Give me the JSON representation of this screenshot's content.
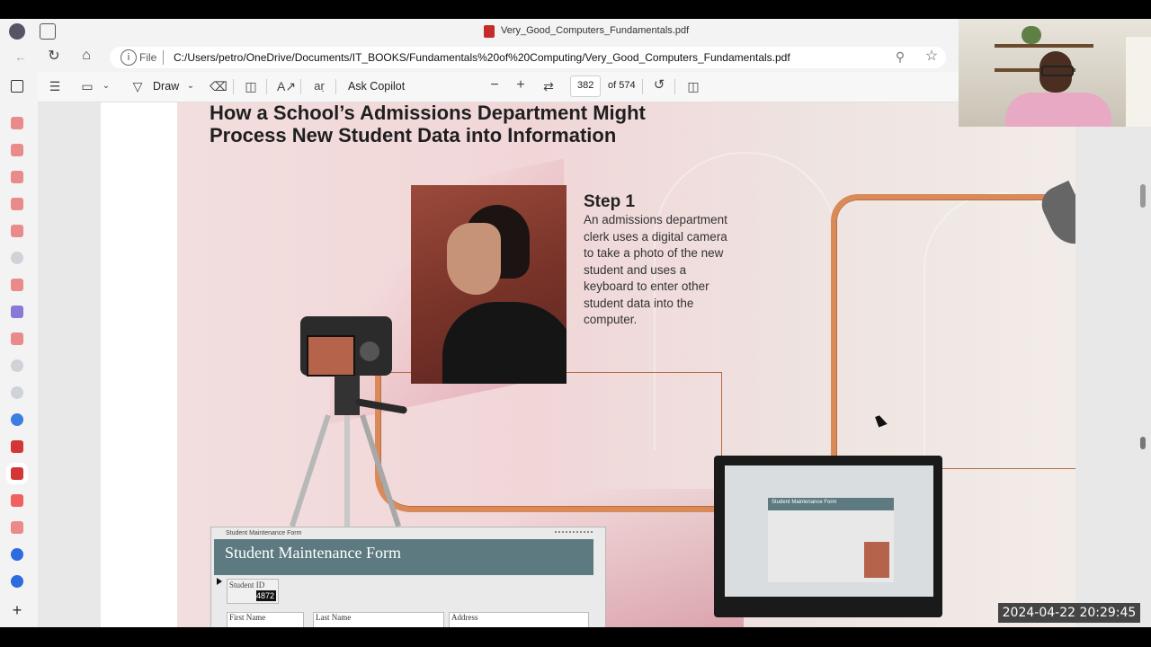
{
  "browser": {
    "tab_title": "Very_Good_Computers_Fundamentals.pdf",
    "address_scheme": "File",
    "address_url": "C:/Users/petro/OneDrive/Documents/IT_BOOKS/Fundamentals%20of%20Computing/Very_Good_Computers_Fundamentals.pdf"
  },
  "pdf_toolbar": {
    "draw_label": "Draw",
    "ask_copilot_label": "Ask Copilot",
    "current_page": "382",
    "page_total": "of 574"
  },
  "page": {
    "heading_line1": "How a School’s Admissions Department Might",
    "heading_line2": "Process New Student Data into Information",
    "step1_title": "Step 1",
    "step1_body": "An admissions department clerk uses a digital camera to take a photo of the new student and uses a keyboard to enter other student data into the computer.",
    "form_window_title": "Student Maintenance Form",
    "form_title": "Student Maintenance Form",
    "student_id_label": "Student ID",
    "student_id_value": "4872",
    "first_name_label": "First Name",
    "last_name_label": "Last Name",
    "address_label": "Address",
    "monitor_form_title": "Student Maintenance Form"
  },
  "overlay": {
    "timestamp": "2024-04-22  20:29:45"
  }
}
